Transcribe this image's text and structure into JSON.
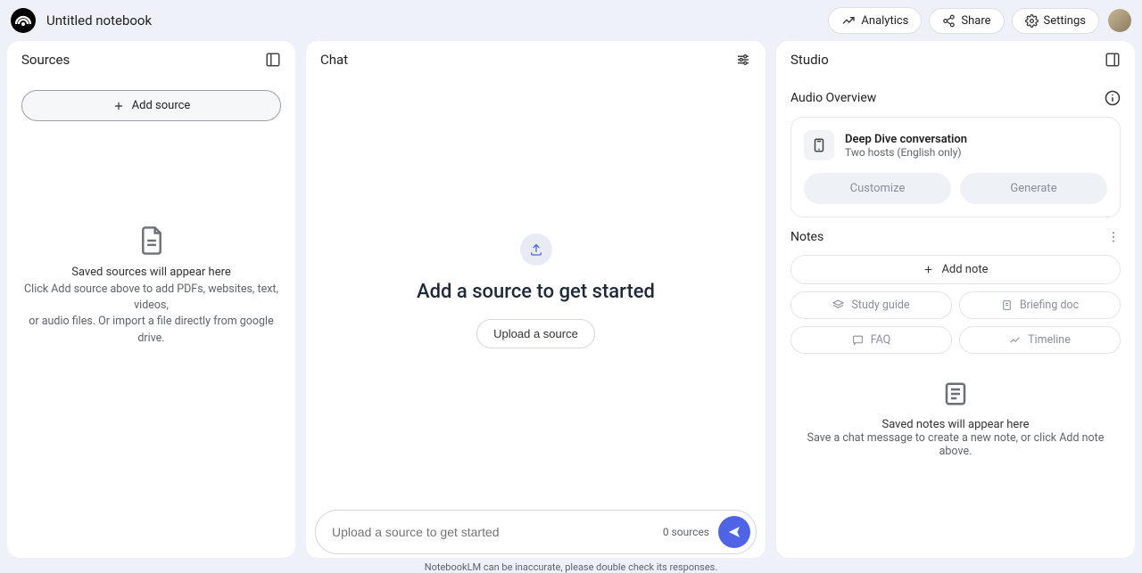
{
  "title": "Untitled notebook",
  "topbar": {
    "analytics": "Analytics",
    "share": "Share",
    "settings": "Settings"
  },
  "sources": {
    "heading": "Sources",
    "add_btn": "Add source",
    "empty_title": "Saved sources will appear here",
    "empty_line1": "Click Add source above to add PDFs, websites, text, videos,",
    "empty_line2": "or audio files. Or import a file directly from google drive."
  },
  "chat": {
    "heading": "Chat",
    "cta_title": "Add a source to get started",
    "upload_btn": "Upload a source",
    "input_placeholder": "Upload a source to get started",
    "src_count": "0 sources"
  },
  "studio": {
    "heading": "Studio",
    "audio_overview_title": "Audio Overview",
    "deep_dive_title": "Deep Dive conversation",
    "deep_dive_sub": "Two hosts (English only)",
    "customize": "Customize",
    "generate": "Generate",
    "notes_title": "Notes",
    "add_note": "Add note",
    "study_guide": "Study guide",
    "briefing_doc": "Briefing doc",
    "faq": "FAQ",
    "timeline": "Timeline",
    "notes_empty_title": "Saved notes will appear here",
    "notes_empty_sub": "Save a chat message to create a new note, or click Add note above."
  },
  "footer": "NotebookLM can be inaccurate, please double check its responses."
}
